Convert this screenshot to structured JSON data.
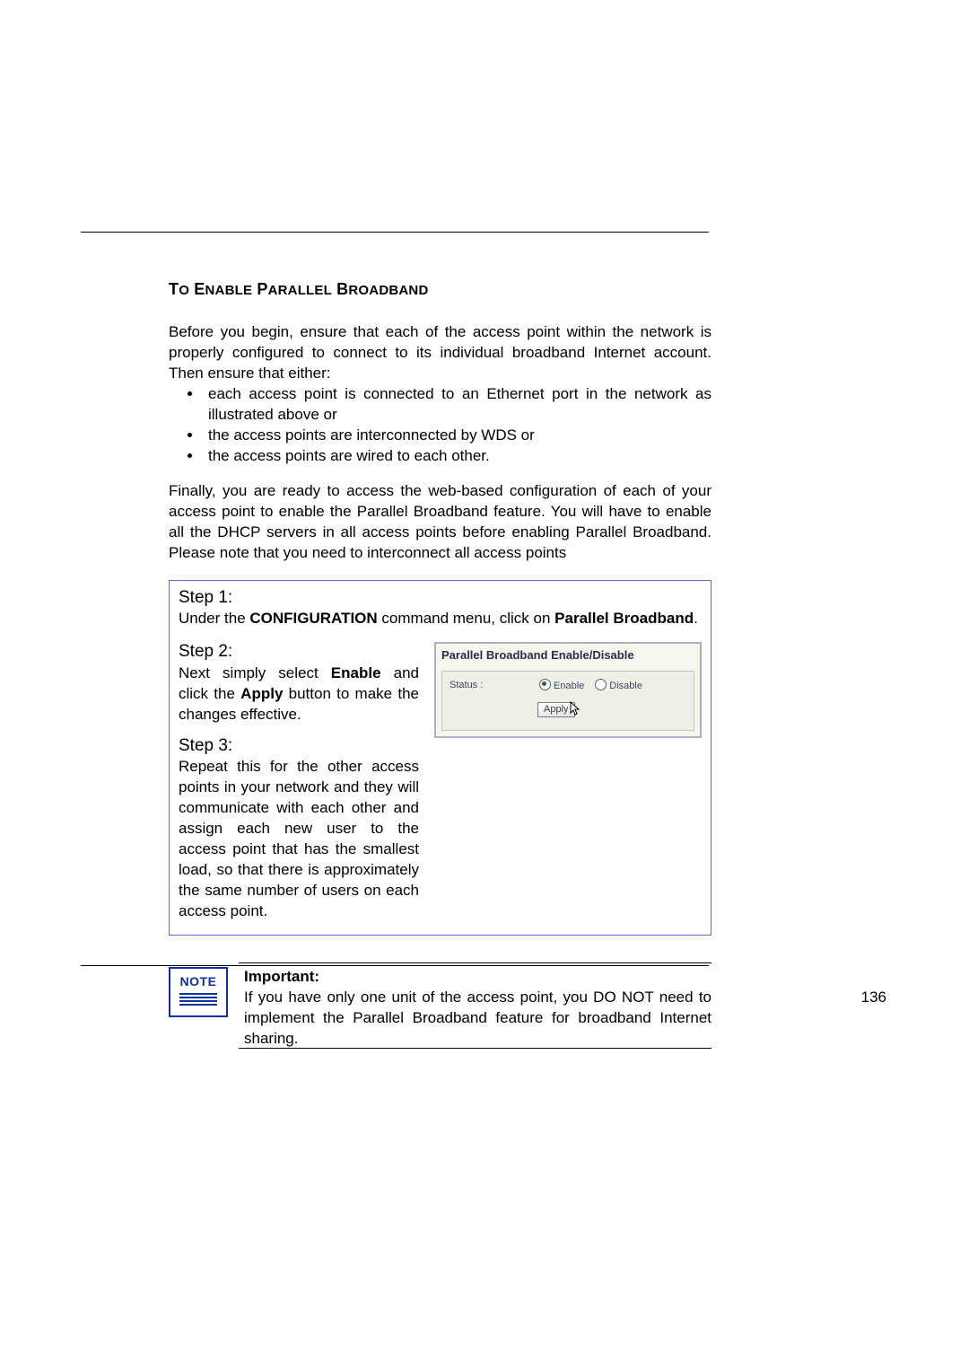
{
  "pageNumber": "136",
  "section": {
    "title": "To Enable Parallel Broadband",
    "intro": "Before you begin, ensure that each of the access point within the network is properly configured to connect to its individual broadband Internet account. Then ensure that either:",
    "bullets": [
      "each access point is connected to an Ethernet port in the network as illustrated above or",
      "the access points are interconnected by WDS or",
      "the access points are wired to each other."
    ],
    "finally": "Finally, you are ready to access the web-based configuration of each of your access point to enable the Parallel Broadband feature. You will have to enable all the DHCP servers in all access points before enabling Parallel Broadband. Please note that you need to interconnect all access points"
  },
  "steps": {
    "s1": {
      "head": "Step 1:",
      "pre": "Under the ",
      "bold1": "CONFIGURATION",
      "mid": " command menu, click on ",
      "bold2": "Parallel Broadband",
      "post": "."
    },
    "s2": {
      "head": "Step 2:",
      "pre": "Next simply select ",
      "bold1": "Enable",
      "mid": " and click the ",
      "bold2": "Apply",
      "post": " button to make the changes effective."
    },
    "s3": {
      "head": "Step 3:",
      "text": "Repeat this for the other access points in your network and they will communicate with each other and assign each new user to the access point that has the smallest load, so that there is approximately the same number of users on each access point."
    }
  },
  "config": {
    "title": "Parallel Broadband Enable/Disable",
    "statusLabel": "Status :",
    "enable": "Enable",
    "disable": "Disable",
    "apply": "Apply"
  },
  "note": {
    "badge": "NOTE",
    "heading": "Important:",
    "text": "If you have only one unit of the access point, you DO NOT need to implement the Parallel Broadband feature for broadband Internet sharing."
  }
}
